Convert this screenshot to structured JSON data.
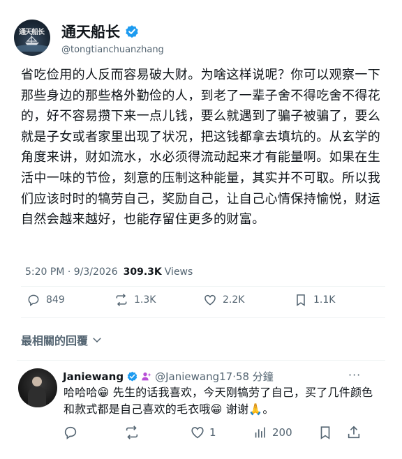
{
  "author": {
    "display_name": "通天船长",
    "handle": "@tongtianchuanzhang",
    "avatar_text": "通天船长",
    "verified_color": "#1d9bf0"
  },
  "post": {
    "text": "省吃俭用的人反而容易破大财。为啥这样说呢？你可以观察一下那些身边的那些格外勤俭的人，到老了一辈子舍不得吃舍不得花的，好不容易攒下来一点儿钱，要么就遇到了骗子被骗了，要么就是子女或者家里出现了状况，把这钱都拿去填坑的。从玄学的角度来讲，财如流水，水必须得流动起来才有能量啊。如果在生活中一味的节俭，刻意的压制这种能量，其实并不可取。所以我们应该时时的犒劳自己，奖励自己，让自己心情保持愉悦，财运自然会越来越好，也能存留住更多的财富。"
  },
  "meta": {
    "time": "5:20 PM · 9/3/2026",
    "views_count": "309.3K",
    "views_label": "Views"
  },
  "actions": {
    "replies": "849",
    "reposts": "1.3K",
    "likes": "2.2K",
    "bookmarks": "1.1K"
  },
  "replies_sort": {
    "label": "最相關的回覆"
  },
  "reply": {
    "name": "Janiewang",
    "handle_time": "@Janiewang17·58 分鐘",
    "more": "···",
    "text_parts": [
      "哈哈哈",
      "😁",
      " 先生的话我喜欢，今天刚犒劳了自己，买了几件颜色和款式都是自己喜欢的毛衣哦",
      "😁",
      " 谢谢",
      "🙏",
      "。"
    ],
    "actions": {
      "likes": "1",
      "views": "200"
    }
  }
}
